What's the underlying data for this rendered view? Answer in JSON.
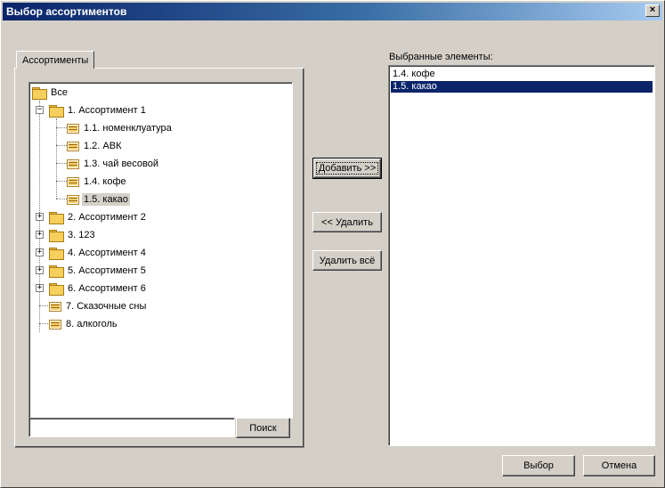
{
  "window": {
    "title": "Выбор ассортиментов",
    "close_glyph": "×"
  },
  "tab": {
    "label": "Ассортименты"
  },
  "tree": {
    "root": {
      "label": "Все",
      "icon": "folder-icon"
    },
    "group1": {
      "label": "1. Ассортимент 1",
      "expander": "−"
    },
    "group1_children": [
      {
        "label": "1.1. номенклуатура",
        "selected": false
      },
      {
        "label": "1.2. АВК",
        "selected": false
      },
      {
        "label": "1.3. чай весовой",
        "selected": false
      },
      {
        "label": "1.4. кофе",
        "selected": false
      },
      {
        "label": "1.5. какао",
        "selected": true
      }
    ],
    "collapsed_groups": [
      {
        "label": "2. Ассортимент 2",
        "expander": "+"
      },
      {
        "label": "3. 123",
        "expander": "+"
      },
      {
        "label": "4. Ассортимент 4",
        "expander": "+"
      },
      {
        "label": "5. Ассортимент 5",
        "expander": "+"
      },
      {
        "label": "6. Ассортимент 6",
        "expander": "+"
      }
    ],
    "leaf_items": [
      {
        "label": "7. Сказочные сны"
      },
      {
        "label": "8. алкоголь"
      }
    ]
  },
  "search": {
    "value": "",
    "button_label": "Поиск"
  },
  "actions": {
    "add_label": "Добавить >>",
    "remove_label": "<< Удалить",
    "remove_all_label": "Удалить всё"
  },
  "selected_panel": {
    "label": "Выбранные элементы:",
    "items": [
      {
        "label": "1.4. кофе",
        "selected": false
      },
      {
        "label": "1.5. какао",
        "selected": true
      }
    ]
  },
  "footer": {
    "ok_label": "Выбор",
    "cancel_label": "Отмена"
  },
  "colors": {
    "titlebar_start": "#0a246a",
    "titlebar_end": "#a6caf0",
    "selection": "#0a246a",
    "face": "#d4d0c8"
  }
}
